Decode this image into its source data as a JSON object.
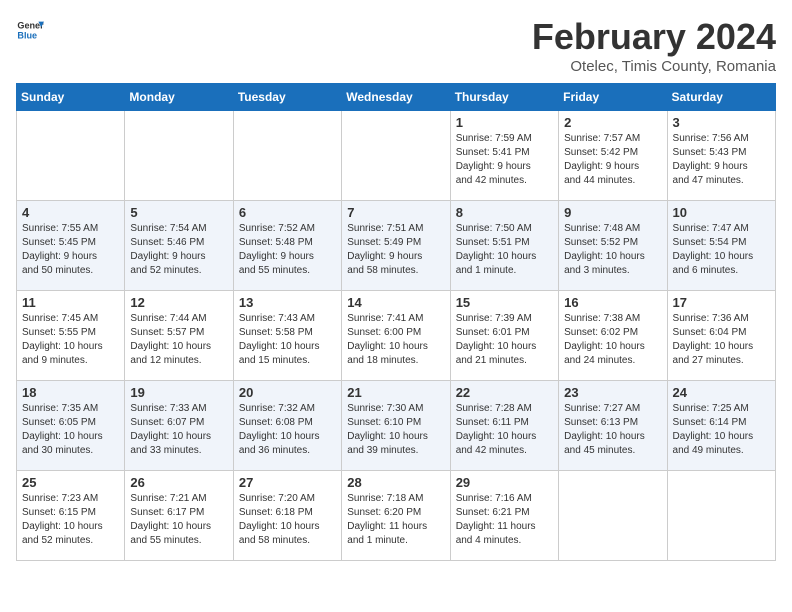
{
  "header": {
    "logo_general": "General",
    "logo_blue": "Blue",
    "title": "February 2024",
    "subtitle": "Otelec, Timis County, Romania"
  },
  "days_of_week": [
    "Sunday",
    "Monday",
    "Tuesday",
    "Wednesday",
    "Thursday",
    "Friday",
    "Saturday"
  ],
  "weeks": [
    [
      {
        "day": "",
        "info": ""
      },
      {
        "day": "",
        "info": ""
      },
      {
        "day": "",
        "info": ""
      },
      {
        "day": "",
        "info": ""
      },
      {
        "day": "1",
        "info": "Sunrise: 7:59 AM\nSunset: 5:41 PM\nDaylight: 9 hours\nand 42 minutes."
      },
      {
        "day": "2",
        "info": "Sunrise: 7:57 AM\nSunset: 5:42 PM\nDaylight: 9 hours\nand 44 minutes."
      },
      {
        "day": "3",
        "info": "Sunrise: 7:56 AM\nSunset: 5:43 PM\nDaylight: 9 hours\nand 47 minutes."
      }
    ],
    [
      {
        "day": "4",
        "info": "Sunrise: 7:55 AM\nSunset: 5:45 PM\nDaylight: 9 hours\nand 50 minutes."
      },
      {
        "day": "5",
        "info": "Sunrise: 7:54 AM\nSunset: 5:46 PM\nDaylight: 9 hours\nand 52 minutes."
      },
      {
        "day": "6",
        "info": "Sunrise: 7:52 AM\nSunset: 5:48 PM\nDaylight: 9 hours\nand 55 minutes."
      },
      {
        "day": "7",
        "info": "Sunrise: 7:51 AM\nSunset: 5:49 PM\nDaylight: 9 hours\nand 58 minutes."
      },
      {
        "day": "8",
        "info": "Sunrise: 7:50 AM\nSunset: 5:51 PM\nDaylight: 10 hours\nand 1 minute."
      },
      {
        "day": "9",
        "info": "Sunrise: 7:48 AM\nSunset: 5:52 PM\nDaylight: 10 hours\nand 3 minutes."
      },
      {
        "day": "10",
        "info": "Sunrise: 7:47 AM\nSunset: 5:54 PM\nDaylight: 10 hours\nand 6 minutes."
      }
    ],
    [
      {
        "day": "11",
        "info": "Sunrise: 7:45 AM\nSunset: 5:55 PM\nDaylight: 10 hours\nand 9 minutes."
      },
      {
        "day": "12",
        "info": "Sunrise: 7:44 AM\nSunset: 5:57 PM\nDaylight: 10 hours\nand 12 minutes."
      },
      {
        "day": "13",
        "info": "Sunrise: 7:43 AM\nSunset: 5:58 PM\nDaylight: 10 hours\nand 15 minutes."
      },
      {
        "day": "14",
        "info": "Sunrise: 7:41 AM\nSunset: 6:00 PM\nDaylight: 10 hours\nand 18 minutes."
      },
      {
        "day": "15",
        "info": "Sunrise: 7:39 AM\nSunset: 6:01 PM\nDaylight: 10 hours\nand 21 minutes."
      },
      {
        "day": "16",
        "info": "Sunrise: 7:38 AM\nSunset: 6:02 PM\nDaylight: 10 hours\nand 24 minutes."
      },
      {
        "day": "17",
        "info": "Sunrise: 7:36 AM\nSunset: 6:04 PM\nDaylight: 10 hours\nand 27 minutes."
      }
    ],
    [
      {
        "day": "18",
        "info": "Sunrise: 7:35 AM\nSunset: 6:05 PM\nDaylight: 10 hours\nand 30 minutes."
      },
      {
        "day": "19",
        "info": "Sunrise: 7:33 AM\nSunset: 6:07 PM\nDaylight: 10 hours\nand 33 minutes."
      },
      {
        "day": "20",
        "info": "Sunrise: 7:32 AM\nSunset: 6:08 PM\nDaylight: 10 hours\nand 36 minutes."
      },
      {
        "day": "21",
        "info": "Sunrise: 7:30 AM\nSunset: 6:10 PM\nDaylight: 10 hours\nand 39 minutes."
      },
      {
        "day": "22",
        "info": "Sunrise: 7:28 AM\nSunset: 6:11 PM\nDaylight: 10 hours\nand 42 minutes."
      },
      {
        "day": "23",
        "info": "Sunrise: 7:27 AM\nSunset: 6:13 PM\nDaylight: 10 hours\nand 45 minutes."
      },
      {
        "day": "24",
        "info": "Sunrise: 7:25 AM\nSunset: 6:14 PM\nDaylight: 10 hours\nand 49 minutes."
      }
    ],
    [
      {
        "day": "25",
        "info": "Sunrise: 7:23 AM\nSunset: 6:15 PM\nDaylight: 10 hours\nand 52 minutes."
      },
      {
        "day": "26",
        "info": "Sunrise: 7:21 AM\nSunset: 6:17 PM\nDaylight: 10 hours\nand 55 minutes."
      },
      {
        "day": "27",
        "info": "Sunrise: 7:20 AM\nSunset: 6:18 PM\nDaylight: 10 hours\nand 58 minutes."
      },
      {
        "day": "28",
        "info": "Sunrise: 7:18 AM\nSunset: 6:20 PM\nDaylight: 11 hours\nand 1 minute."
      },
      {
        "day": "29",
        "info": "Sunrise: 7:16 AM\nSunset: 6:21 PM\nDaylight: 11 hours\nand 4 minutes."
      },
      {
        "day": "",
        "info": ""
      },
      {
        "day": "",
        "info": ""
      }
    ]
  ]
}
